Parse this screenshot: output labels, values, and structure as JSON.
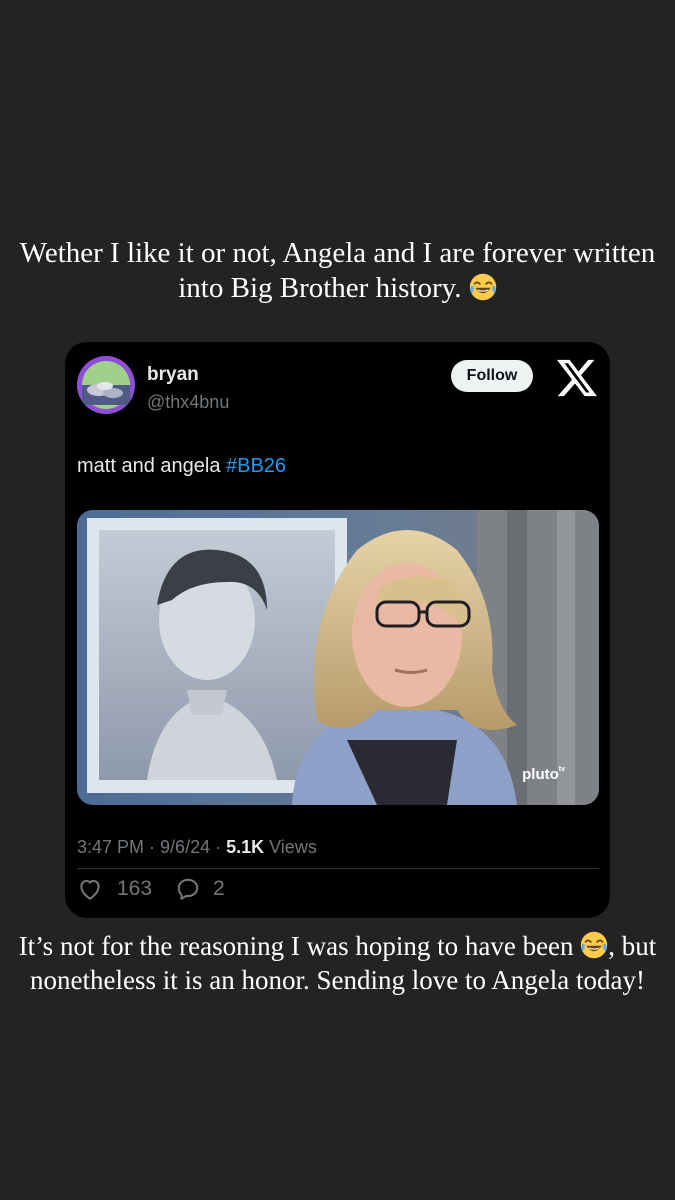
{
  "story": {
    "caption_top": "Wether I like it or not, Angela and I are forever written into Big Brother history.",
    "caption_bottom_before": "It’s not for the reasoning I was hoping to have been",
    "caption_bottom_after": ", but nonetheless it is an honor. Sending love to Angela today!",
    "emoji_name": "face-with-tears-of-joy"
  },
  "tweet": {
    "display_name": "bryan",
    "handle": "@thx4bnu",
    "follow_label": "Follow",
    "platform_logo": "x-logo",
    "text": "matt and angela ",
    "hashtag": "#BB26",
    "media_watermark": "pluto",
    "media_watermark_sup": "tv",
    "time": "3:47 PM",
    "date": "9/6/24",
    "separator": " · ",
    "views_count": "5.1K",
    "views_label": " Views",
    "likes": "163",
    "replies": "2"
  },
  "colors": {
    "background": "#232323",
    "card": "#000000",
    "link": "#1d9bf0",
    "muted": "#71767b"
  }
}
